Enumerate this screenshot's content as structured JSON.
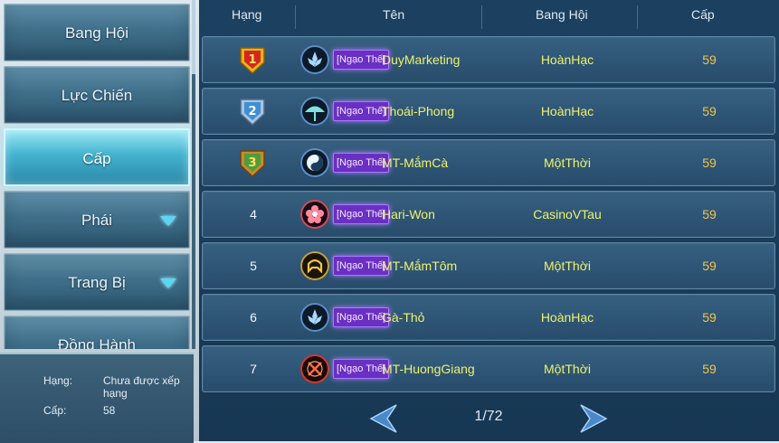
{
  "sidebar": {
    "tabs": [
      {
        "label": "Bang Hội"
      },
      {
        "label": "Lực Chiến"
      },
      {
        "label": "Cấp"
      },
      {
        "label": "Phái"
      },
      {
        "label": "Trang Bị"
      },
      {
        "label": "Đồng Hành"
      }
    ],
    "active_tab": "Cấp"
  },
  "player_info": {
    "rank_label": "Hạng:",
    "rank_value": "Chưa được xếp hạng",
    "level_label": "Cấp:",
    "level_value": "58"
  },
  "table": {
    "headers": {
      "rank": "Hạng",
      "name": "Tên",
      "guild": "Bang Hội",
      "level": "Cấp"
    },
    "rows": [
      {
        "rank": "1",
        "emblem": "lotus-emblem-icon",
        "tag": "[Ngạo Thế]",
        "name": "DuyMarketing",
        "guild": "HoànHạc",
        "level": "59"
      },
      {
        "rank": "2",
        "emblem": "umbrella-emblem-icon",
        "tag": "[Ngạo Thế]",
        "name": "Thoái-Phong",
        "guild": "HoànHạc",
        "level": "59"
      },
      {
        "rank": "3",
        "emblem": "yin-yang-emblem-icon",
        "tag": "[Ngạo Thế]",
        "name": "MT-MắmCà",
        "guild": "MộtThời",
        "level": "59"
      },
      {
        "rank": "4",
        "emblem": "flower-emblem-icon",
        "tag": "[Ngạo Thế]",
        "name": "Hari-Won",
        "guild": "CasinoVTau",
        "level": "59"
      },
      {
        "rank": "5",
        "emblem": "helmet-emblem-icon",
        "tag": "[Ngạo Thế]",
        "name": "MT-MắmTôm",
        "guild": "MộtThời",
        "level": "59"
      },
      {
        "rank": "6",
        "emblem": "lotus-emblem-icon",
        "tag": "[Ngạo Thế]",
        "name": "Gà-Thỏ",
        "guild": "HoànHạc",
        "level": "59"
      },
      {
        "rank": "7",
        "emblem": "swords-emblem-icon",
        "tag": "[Ngạo Thế]",
        "name": "MT-HuongGiang",
        "guild": "MộtThời",
        "level": "59"
      }
    ]
  },
  "pagination": {
    "label": "1/72",
    "current": 1,
    "total": 72
  },
  "colors": {
    "name_text": "#eef26a",
    "level_text": "#f2c547",
    "tag_bg": "#6a2fc3",
    "gold_badge": "#e8b41c",
    "silver_badge": "#a8c4df",
    "bronze_badge": "#6aa84a"
  }
}
